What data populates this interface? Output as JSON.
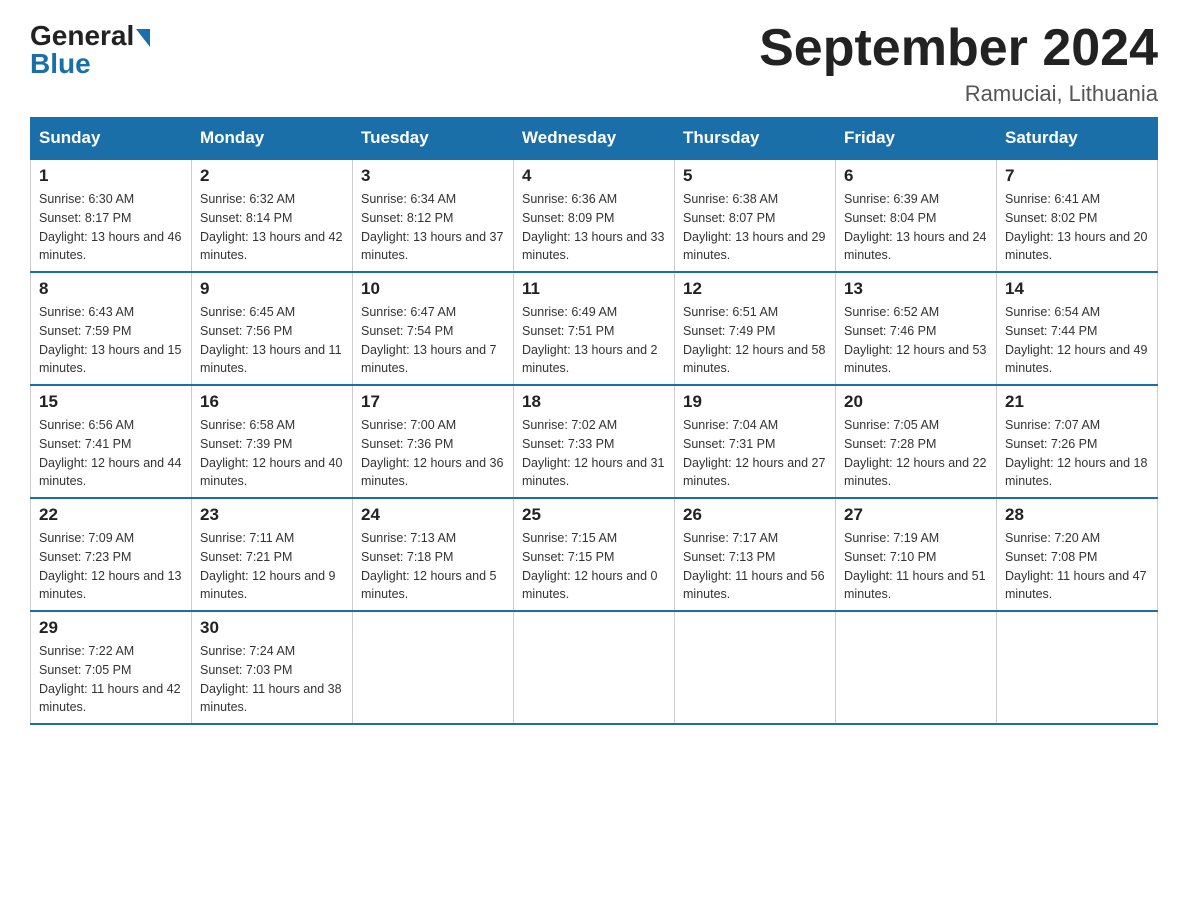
{
  "logo": {
    "general": "General",
    "blue": "Blue"
  },
  "title": "September 2024",
  "location": "Ramuciai, Lithuania",
  "days_header": [
    "Sunday",
    "Monday",
    "Tuesday",
    "Wednesday",
    "Thursday",
    "Friday",
    "Saturday"
  ],
  "weeks": [
    [
      {
        "day": "1",
        "sunrise": "6:30 AM",
        "sunset": "8:17 PM",
        "daylight": "13 hours and 46 minutes."
      },
      {
        "day": "2",
        "sunrise": "6:32 AM",
        "sunset": "8:14 PM",
        "daylight": "13 hours and 42 minutes."
      },
      {
        "day": "3",
        "sunrise": "6:34 AM",
        "sunset": "8:12 PM",
        "daylight": "13 hours and 37 minutes."
      },
      {
        "day": "4",
        "sunrise": "6:36 AM",
        "sunset": "8:09 PM",
        "daylight": "13 hours and 33 minutes."
      },
      {
        "day": "5",
        "sunrise": "6:38 AM",
        "sunset": "8:07 PM",
        "daylight": "13 hours and 29 minutes."
      },
      {
        "day": "6",
        "sunrise": "6:39 AM",
        "sunset": "8:04 PM",
        "daylight": "13 hours and 24 minutes."
      },
      {
        "day": "7",
        "sunrise": "6:41 AM",
        "sunset": "8:02 PM",
        "daylight": "13 hours and 20 minutes."
      }
    ],
    [
      {
        "day": "8",
        "sunrise": "6:43 AM",
        "sunset": "7:59 PM",
        "daylight": "13 hours and 15 minutes."
      },
      {
        "day": "9",
        "sunrise": "6:45 AM",
        "sunset": "7:56 PM",
        "daylight": "13 hours and 11 minutes."
      },
      {
        "day": "10",
        "sunrise": "6:47 AM",
        "sunset": "7:54 PM",
        "daylight": "13 hours and 7 minutes."
      },
      {
        "day": "11",
        "sunrise": "6:49 AM",
        "sunset": "7:51 PM",
        "daylight": "13 hours and 2 minutes."
      },
      {
        "day": "12",
        "sunrise": "6:51 AM",
        "sunset": "7:49 PM",
        "daylight": "12 hours and 58 minutes."
      },
      {
        "day": "13",
        "sunrise": "6:52 AM",
        "sunset": "7:46 PM",
        "daylight": "12 hours and 53 minutes."
      },
      {
        "day": "14",
        "sunrise": "6:54 AM",
        "sunset": "7:44 PM",
        "daylight": "12 hours and 49 minutes."
      }
    ],
    [
      {
        "day": "15",
        "sunrise": "6:56 AM",
        "sunset": "7:41 PM",
        "daylight": "12 hours and 44 minutes."
      },
      {
        "day": "16",
        "sunrise": "6:58 AM",
        "sunset": "7:39 PM",
        "daylight": "12 hours and 40 minutes."
      },
      {
        "day": "17",
        "sunrise": "7:00 AM",
        "sunset": "7:36 PM",
        "daylight": "12 hours and 36 minutes."
      },
      {
        "day": "18",
        "sunrise": "7:02 AM",
        "sunset": "7:33 PM",
        "daylight": "12 hours and 31 minutes."
      },
      {
        "day": "19",
        "sunrise": "7:04 AM",
        "sunset": "7:31 PM",
        "daylight": "12 hours and 27 minutes."
      },
      {
        "day": "20",
        "sunrise": "7:05 AM",
        "sunset": "7:28 PM",
        "daylight": "12 hours and 22 minutes."
      },
      {
        "day": "21",
        "sunrise": "7:07 AM",
        "sunset": "7:26 PM",
        "daylight": "12 hours and 18 minutes."
      }
    ],
    [
      {
        "day": "22",
        "sunrise": "7:09 AM",
        "sunset": "7:23 PM",
        "daylight": "12 hours and 13 minutes."
      },
      {
        "day": "23",
        "sunrise": "7:11 AM",
        "sunset": "7:21 PM",
        "daylight": "12 hours and 9 minutes."
      },
      {
        "day": "24",
        "sunrise": "7:13 AM",
        "sunset": "7:18 PM",
        "daylight": "12 hours and 5 minutes."
      },
      {
        "day": "25",
        "sunrise": "7:15 AM",
        "sunset": "7:15 PM",
        "daylight": "12 hours and 0 minutes."
      },
      {
        "day": "26",
        "sunrise": "7:17 AM",
        "sunset": "7:13 PM",
        "daylight": "11 hours and 56 minutes."
      },
      {
        "day": "27",
        "sunrise": "7:19 AM",
        "sunset": "7:10 PM",
        "daylight": "11 hours and 51 minutes."
      },
      {
        "day": "28",
        "sunrise": "7:20 AM",
        "sunset": "7:08 PM",
        "daylight": "11 hours and 47 minutes."
      }
    ],
    [
      {
        "day": "29",
        "sunrise": "7:22 AM",
        "sunset": "7:05 PM",
        "daylight": "11 hours and 42 minutes."
      },
      {
        "day": "30",
        "sunrise": "7:24 AM",
        "sunset": "7:03 PM",
        "daylight": "11 hours and 38 minutes."
      },
      null,
      null,
      null,
      null,
      null
    ]
  ]
}
